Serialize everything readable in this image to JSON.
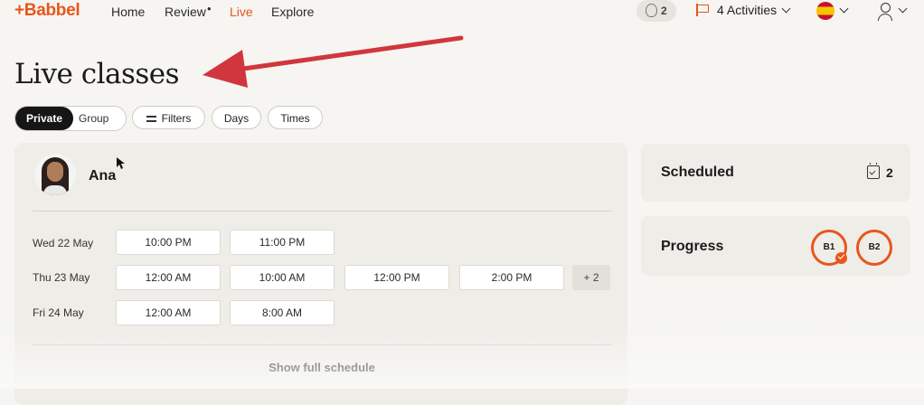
{
  "nav": {
    "logo": "+Babbel",
    "links": [
      "Home",
      "Review",
      "Live",
      "Explore"
    ],
    "active": "Live",
    "streak_count": "2",
    "activities": "4 Activities"
  },
  "page": {
    "title": "Live classes"
  },
  "filters": {
    "segment": [
      "Private",
      "Group"
    ],
    "selected": "Private",
    "pills": [
      "Filters",
      "Days",
      "Times"
    ]
  },
  "tutor": {
    "name": "Ana",
    "schedule": [
      {
        "day": "Wed 22 May",
        "slots": [
          "10:00 PM",
          "11:00 PM"
        ]
      },
      {
        "day": "Thu 23 May",
        "slots": [
          "12:00 AM",
          "10:00 AM",
          "12:00 PM",
          "2:00 PM"
        ],
        "more": "+ 2"
      },
      {
        "day": "Fri 24 May",
        "slots": [
          "12:00 AM",
          "8:00 AM"
        ]
      }
    ],
    "show_full": "Show full schedule"
  },
  "sidebar": {
    "scheduled_label": "Scheduled",
    "scheduled_count": "2",
    "progress_label": "Progress",
    "levels": [
      "B1",
      "B2"
    ]
  },
  "colors": {
    "accent": "#e8561c",
    "arrow": "#d1363e"
  }
}
